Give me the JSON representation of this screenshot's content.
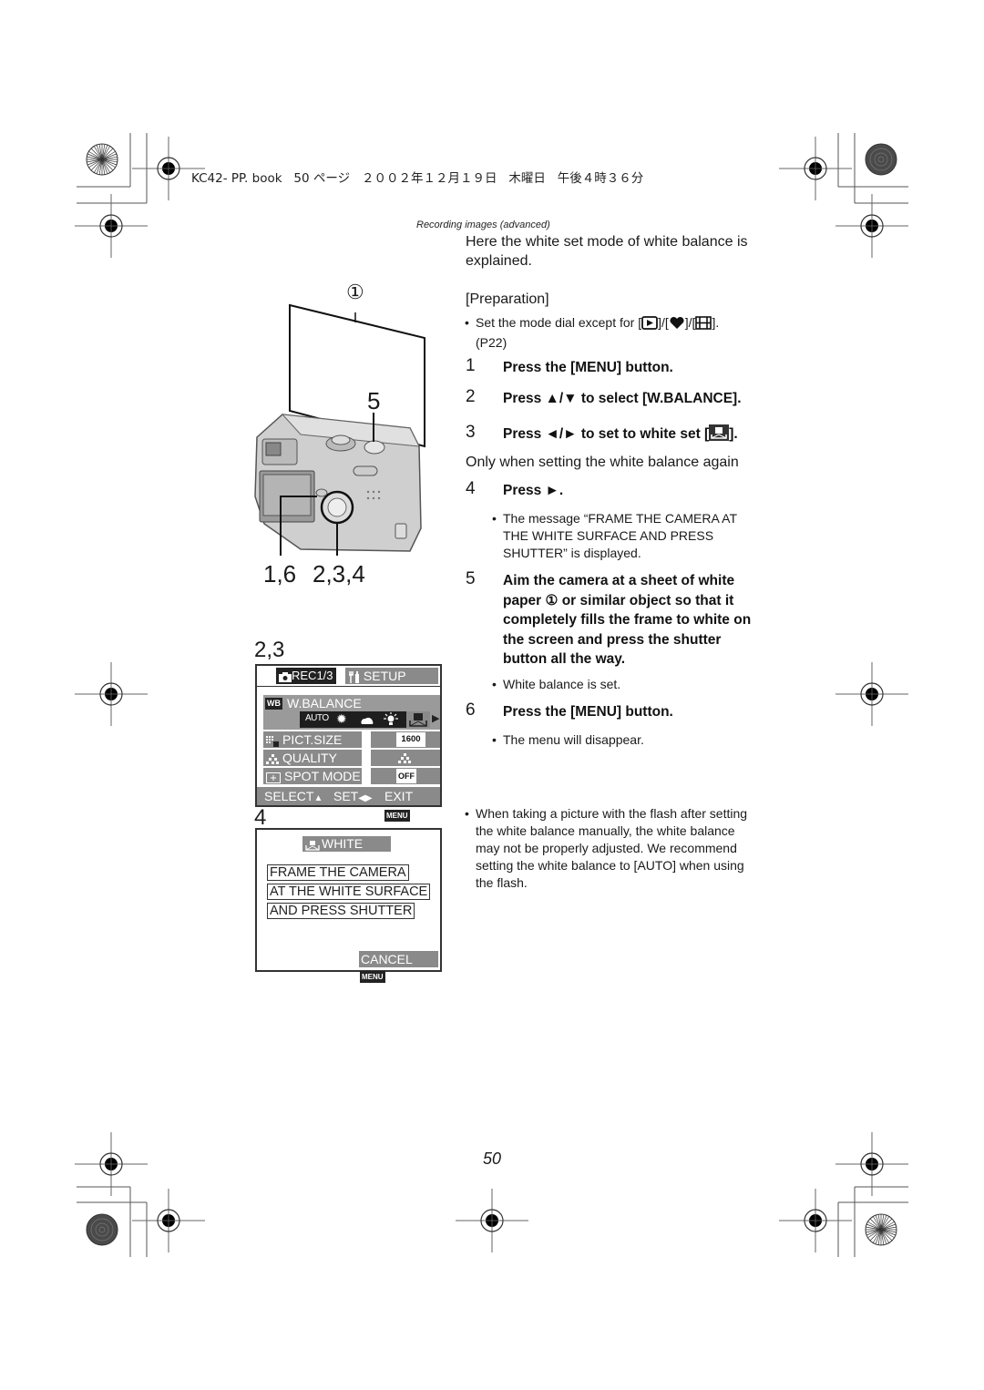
{
  "header": {
    "file_info": "KC42- PP. book   50 ページ   ２００２年１２月１９日   木曜日   午後４時３６分"
  },
  "section_title": "Recording images (advanced)",
  "intro": {
    "line1": "Here the white set mode of white balance is",
    "line2": "explained."
  },
  "preparation": {
    "heading": "[Preparation]",
    "bullet_prefix": "Set the mode dial except for [",
    "bullet_sep1": "]/[",
    "bullet_sep2": "]/[",
    "bullet_suffix": "].",
    "bullet_ref": "(P22)",
    "icons": [
      "playback-icon",
      "heart-icon",
      "motion-picture-icon"
    ]
  },
  "steps": [
    {
      "num": "1",
      "text": "Press the [MENU] button."
    },
    {
      "num": "2",
      "text": "Press ▲/▼ to select [W.BALANCE]."
    },
    {
      "num": "3",
      "text_before": "Press ◄/► to set to white set [",
      "text_after": "]."
    },
    {
      "num": "4",
      "text": "Press ►."
    },
    {
      "num": "5",
      "lines": [
        "Aim the camera at a sheet of white",
        "paper ① or similar object so that it",
        "completely fills the frame to white on",
        "the screen and press the shutter",
        "button all the way."
      ]
    },
    {
      "num": "6",
      "text": "Press the [MENU] button."
    }
  ],
  "note_only_when": "Only when setting the white balance again",
  "step4_bullet": [
    "The message “FRAME THE CAMERA AT",
    "THE WHITE SURFACE AND PRESS",
    "SHUTTER” is displayed."
  ],
  "step5_bullet": "White balance is set.",
  "step6_bullet": "The menu will disappear.",
  "flash_note": [
    "When taking a picture with the flash after setting",
    "the white balance manually, the white balance",
    "may not be properly adjusted. We recommend",
    "setting the white balance to [AUTO] when using",
    "the flash."
  ],
  "illustration": {
    "paper_callout": "①",
    "shutter_label": "5",
    "bottom_label_left": "1,6",
    "bottom_label_right": "2,3,4"
  },
  "menu_screen": {
    "label": "2,3",
    "tab_rec": "REC1/3",
    "tab_setup": "SETUP",
    "wb_badge": "WB",
    "wb_label": "W.BALANCE",
    "wb_options": [
      "AUTO",
      "sunny",
      "cloudy",
      "incandescent",
      "white-set"
    ],
    "rows": [
      {
        "label": "PICT.SIZE",
        "value": "1600",
        "icon": "pict-size-icon"
      },
      {
        "label": "QUALITY",
        "value": "quality",
        "icon": "quality-icon"
      },
      {
        "label": "SPOT MODE",
        "value": "OFF",
        "icon": "spot-mode-icon"
      }
    ],
    "footer_select": "SELECT",
    "footer_set": "SET",
    "footer_exit": "EXIT",
    "menu_tag": "MENU"
  },
  "white_set_screen": {
    "label": "4",
    "title": "WHITE SET",
    "message": [
      "FRAME THE CAMERA",
      "AT THE WHITE SURFACE",
      "AND PRESS SHUTTER"
    ],
    "cancel": "CANCEL",
    "menu_tag": "MENU"
  },
  "page_number": "50"
}
